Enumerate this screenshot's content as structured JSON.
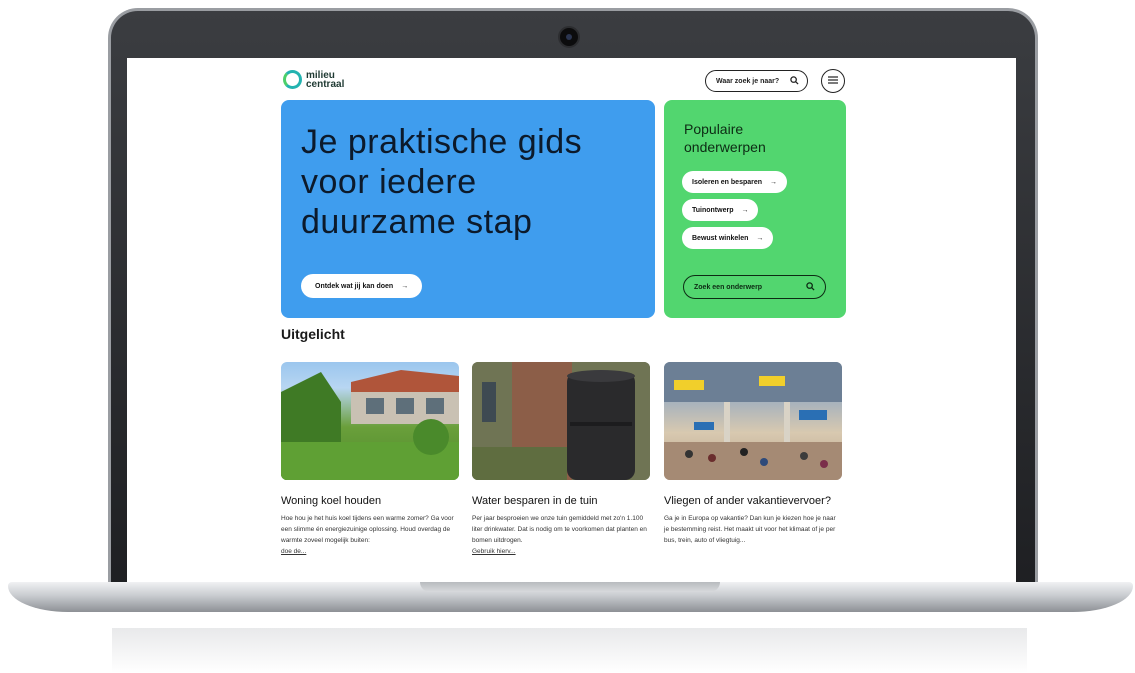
{
  "brand": {
    "logo_line1": "milieu",
    "logo_line2": "centraal"
  },
  "header": {
    "search_label": "Waar zoek je naar?"
  },
  "hero": {
    "title": "Je praktische gids voor iedere duurzame stap",
    "cta_label": "Ontdek wat jij kan doen"
  },
  "popular": {
    "title": "Populaire onderwerpen",
    "topics": [
      "Isoleren en besparen",
      "Tuinontwerp",
      "Bewust winkelen"
    ],
    "search_label": "Zoek een onderwerp"
  },
  "featured": {
    "title": "Uitgelicht",
    "cards": [
      {
        "title": "Woning koel houden",
        "text": "Hoe hou je het huis koel tijdens een warme zomer? Ga voor een slimme én energiezuinige oplossing. Houd overdag de warmte zoveel mogelijk buiten:",
        "more": "doe de..."
      },
      {
        "title": "Water besparen in de tuin",
        "text": "Per jaar besproeien we onze tuin gemiddeld met zo'n 1.100 liter drinkwater. Dat is nodig om te voorkomen dat planten en bomen uitdrogen.",
        "more": "Gebruik hierv..."
      },
      {
        "title": "Vliegen of ander vakantievervoer?",
        "text": "Ga je in Europa op vakantie? Dan kun je kiezen hoe je naar je bestemming reist. Het maakt uit voor het klimaat of je per bus, trein, auto of vliegtuig...",
        "more": ""
      }
    ]
  },
  "colors": {
    "hero_blue": "#3f9dee",
    "popular_green": "#52d66f",
    "logo_teal": "#23b3b0"
  },
  "icons": {
    "search": "search-icon",
    "menu": "menu-icon",
    "arrow": "arrow-right-icon"
  }
}
